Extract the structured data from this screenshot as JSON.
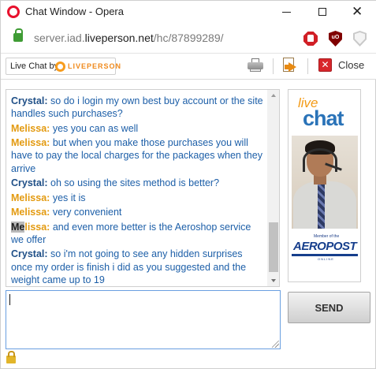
{
  "window": {
    "title": "Chat Window - Opera",
    "controls": {
      "minimize": "minimize",
      "maximize": "maximize",
      "close": "✕"
    }
  },
  "address": {
    "url_prefix": "server.iad.",
    "url_host": "liveperson.net",
    "url_path": "/hc/87899289/"
  },
  "extensions": [
    "stop-icon",
    "ublock-icon",
    "shield-icon"
  ],
  "toolbar": {
    "badge_prefix": "Live Chat by",
    "badge_brand": "LIVEPERSON",
    "close_label": "Close"
  },
  "transcript": [
    {
      "who": "Crystal:",
      "role": "visitor",
      "text": "so do i login my own best buy account or the site handles such purchases?"
    },
    {
      "who": "Melissa:",
      "role": "agent",
      "text": "yes you can as well"
    },
    {
      "who": "Melissa:",
      "role": "agent",
      "text": "but when you make those purchases you will have to pay the local charges for the packages when they arrive"
    },
    {
      "who": "Crystal:",
      "role": "visitor",
      "text": "oh so using the sites method is better?"
    },
    {
      "who": "Melissa:",
      "role": "agent",
      "text": "yes it is"
    },
    {
      "who": "Melissa:",
      "role": "agent",
      "text": "very convenient"
    },
    {
      "who_highlight": "Me",
      "who_rest": "lissa:",
      "role": "agent",
      "text": "and even more better is the Aeroshop service we offer"
    },
    {
      "who": "Crystal:",
      "role": "visitor",
      "text": "so i'm not going to see any hidden surprises once my order is finish i did as you suggested and the weight came up to 19"
    }
  ],
  "ad": {
    "live": "live",
    "chat": "chat",
    "tagline": "Member of the",
    "brand": "AEROPOST",
    "sub": "ONLINE"
  },
  "composer": {
    "value": "",
    "send_label": "SEND"
  },
  "colors": {
    "visitor": "#1f4f87",
    "agent": "#e39a10",
    "message": "#1d5fa8",
    "secure": "#3f9c35"
  }
}
